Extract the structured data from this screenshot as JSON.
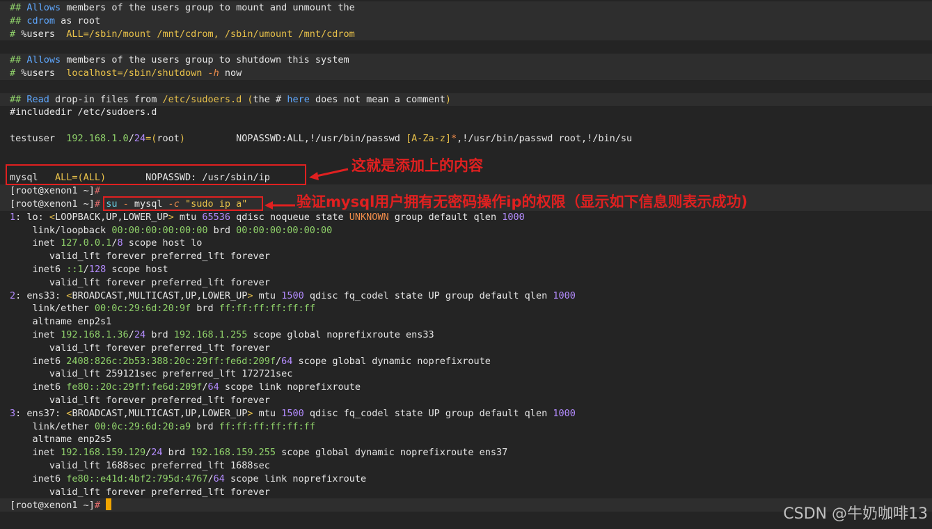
{
  "lines": [
    {
      "row": 0,
      "band": true,
      "segs": [
        {
          "t": "##",
          "c": "cmt"
        },
        {
          "t": " Allows",
          "c": "blue"
        },
        {
          "t": " members of the users group to mount and unmount the",
          "c": "wht"
        }
      ]
    },
    {
      "row": 1,
      "band": true,
      "segs": [
        {
          "t": "##",
          "c": "cmt"
        },
        {
          "t": " cdrom",
          "c": "blue"
        },
        {
          "t": " as root",
          "c": "wht"
        }
      ]
    },
    {
      "row": 2,
      "band": true,
      "segs": [
        {
          "t": "#",
          "c": "cmt"
        },
        {
          "t": " %users  ",
          "c": "wht"
        },
        {
          "t": "ALL=/sbin/mount /mnt/cdrom, /sbin/umount /mnt/cdrom",
          "c": "yel"
        }
      ]
    },
    {
      "row": 4,
      "band": true,
      "segs": [
        {
          "t": "##",
          "c": "cmt"
        },
        {
          "t": " Allows",
          "c": "blue"
        },
        {
          "t": " members of the users group to shutdown this system",
          "c": "wht"
        }
      ]
    },
    {
      "row": 5,
      "band": true,
      "segs": [
        {
          "t": "#",
          "c": "cmt"
        },
        {
          "t": " %users  ",
          "c": "wht"
        },
        {
          "t": "localhost=/sbin/shutdown ",
          "c": "yel"
        },
        {
          "t": "-h",
          "c": "org ital"
        },
        {
          "t": " now",
          "c": "wht"
        }
      ]
    },
    {
      "row": 7,
      "band": true,
      "segs": [
        {
          "t": "##",
          "c": "cmt"
        },
        {
          "t": " Read",
          "c": "blue"
        },
        {
          "t": " drop-in files from ",
          "c": "wht"
        },
        {
          "t": "/etc/sudoers.d",
          "c": "yel"
        },
        {
          "t": " (",
          "c": "yel"
        },
        {
          "t": "the # ",
          "c": "wht"
        },
        {
          "t": "here",
          "c": "blue"
        },
        {
          "t": " does not mean a comment",
          "c": "wht"
        },
        {
          "t": ")",
          "c": "yel"
        }
      ]
    },
    {
      "row": 8,
      "band": false,
      "segs": [
        {
          "t": "#includedir /etc/sudoers.d",
          "c": "wht"
        }
      ]
    },
    {
      "row": 10,
      "band": false,
      "segs": [
        {
          "t": "testuser  ",
          "c": "wht"
        },
        {
          "t": "192.168.1.0",
          "c": "grn"
        },
        {
          "t": "/",
          "c": "wht"
        },
        {
          "t": "24",
          "c": "pur"
        },
        {
          "t": "=(",
          "c": "yel"
        },
        {
          "t": "root",
          "c": "wht"
        },
        {
          "t": ")",
          "c": "yel"
        },
        {
          "t": "         NOPASSWD:ALL,!/usr/bin/passwd ",
          "c": "wht"
        },
        {
          "t": "[A-Za-z]",
          "c": "yel"
        },
        {
          "t": "*",
          "c": "org"
        },
        {
          "t": ",!/usr/bin/passwd root,!/bin/su",
          "c": "wht"
        }
      ]
    },
    {
      "row": 13,
      "band": false,
      "segs": [
        {
          "t": "mysql   ",
          "c": "wht"
        },
        {
          "t": "ALL=(ALL)",
          "c": "yel"
        },
        {
          "t": "       NOPASSWD: /usr/sbin/ip",
          "c": "wht"
        }
      ]
    },
    {
      "row": 14,
      "band": true,
      "segs": [
        {
          "t": "[root@xenon1 ~]",
          "c": "wht"
        },
        {
          "t": "#",
          "c": "red"
        }
      ]
    },
    {
      "row": 15,
      "band": true,
      "segs": [
        {
          "t": "[root@xenon1 ~]",
          "c": "wht"
        },
        {
          "t": "# ",
          "c": "red"
        },
        {
          "t": "su",
          "c": "cya"
        },
        {
          "t": " - ",
          "c": "org"
        },
        {
          "t": "mysql ",
          "c": "wht"
        },
        {
          "t": "-c",
          "c": "org ital"
        },
        {
          "t": " \"sudo ip a\"",
          "c": "yel"
        }
      ]
    },
    {
      "row": 16,
      "band": false,
      "segs": [
        {
          "t": "1",
          "c": "pur"
        },
        {
          "t": ": lo: ",
          "c": "wht"
        },
        {
          "t": "<",
          "c": "yel"
        },
        {
          "t": "LOOPBACK,UP,LOWER_UP",
          "c": "wht"
        },
        {
          "t": ">",
          "c": "yel"
        },
        {
          "t": " mtu ",
          "c": "wht"
        },
        {
          "t": "65536",
          "c": "pur"
        },
        {
          "t": " qdisc noqueue state ",
          "c": "wht"
        },
        {
          "t": "UNKNOWN",
          "c": "org"
        },
        {
          "t": " group default qlen ",
          "c": "wht"
        },
        {
          "t": "1000",
          "c": "pur"
        }
      ]
    },
    {
      "row": 17,
      "band": false,
      "segs": [
        {
          "t": "    link/loopback ",
          "c": "wht"
        },
        {
          "t": "00:00:00:00:00:00",
          "c": "grn"
        },
        {
          "t": " brd ",
          "c": "wht"
        },
        {
          "t": "00:00:00:00:00:00",
          "c": "grn"
        }
      ]
    },
    {
      "row": 18,
      "band": false,
      "segs": [
        {
          "t": "    inet ",
          "c": "wht"
        },
        {
          "t": "127.0.0.1",
          "c": "grn"
        },
        {
          "t": "/",
          "c": "wht"
        },
        {
          "t": "8",
          "c": "pur"
        },
        {
          "t": " scope host lo",
          "c": "wht"
        }
      ]
    },
    {
      "row": 19,
      "band": false,
      "segs": [
        {
          "t": "       valid_lft forever preferred_lft forever",
          "c": "wht"
        }
      ]
    },
    {
      "row": 20,
      "band": false,
      "segs": [
        {
          "t": "    inet6 ",
          "c": "wht"
        },
        {
          "t": "::1",
          "c": "grn"
        },
        {
          "t": "/",
          "c": "wht"
        },
        {
          "t": "128",
          "c": "pur"
        },
        {
          "t": " scope host",
          "c": "wht"
        }
      ]
    },
    {
      "row": 21,
      "band": false,
      "segs": [
        {
          "t": "       valid_lft forever preferred_lft forever",
          "c": "wht"
        }
      ]
    },
    {
      "row": 22,
      "band": false,
      "segs": [
        {
          "t": "2",
          "c": "pur"
        },
        {
          "t": ": ens33: ",
          "c": "wht"
        },
        {
          "t": "<",
          "c": "yel"
        },
        {
          "t": "BROADCAST,MULTICAST,UP,LOWER_UP",
          "c": "wht"
        },
        {
          "t": ">",
          "c": "yel"
        },
        {
          "t": " mtu ",
          "c": "wht"
        },
        {
          "t": "1500",
          "c": "pur"
        },
        {
          "t": " qdisc fq_codel state UP group default qlen ",
          "c": "wht"
        },
        {
          "t": "1000",
          "c": "pur"
        }
      ]
    },
    {
      "row": 23,
      "band": false,
      "segs": [
        {
          "t": "    link/ether ",
          "c": "wht"
        },
        {
          "t": "00:0c:29:6d:20:9f",
          "c": "grn"
        },
        {
          "t": " brd ",
          "c": "wht"
        },
        {
          "t": "ff:ff:ff:ff:ff:ff",
          "c": "grn"
        }
      ]
    },
    {
      "row": 24,
      "band": false,
      "segs": [
        {
          "t": "    altname enp2s1",
          "c": "wht"
        }
      ]
    },
    {
      "row": 25,
      "band": false,
      "segs": [
        {
          "t": "    inet ",
          "c": "wht"
        },
        {
          "t": "192.168.1.36",
          "c": "grn"
        },
        {
          "t": "/",
          "c": "wht"
        },
        {
          "t": "24",
          "c": "pur"
        },
        {
          "t": " brd ",
          "c": "wht"
        },
        {
          "t": "192.168.1.255",
          "c": "grn"
        },
        {
          "t": " scope global noprefixroute ens33",
          "c": "wht"
        }
      ]
    },
    {
      "row": 26,
      "band": false,
      "segs": [
        {
          "t": "       valid_lft forever preferred_lft forever",
          "c": "wht"
        }
      ]
    },
    {
      "row": 27,
      "band": false,
      "segs": [
        {
          "t": "    inet6 ",
          "c": "wht"
        },
        {
          "t": "2408:826c:2b53:388:20c:29ff:fe6d:209f",
          "c": "grn"
        },
        {
          "t": "/",
          "c": "wht"
        },
        {
          "t": "64",
          "c": "pur"
        },
        {
          "t": " scope global dynamic noprefixroute",
          "c": "wht"
        }
      ]
    },
    {
      "row": 28,
      "band": false,
      "segs": [
        {
          "t": "       valid_lft 259121sec preferred_lft 172721sec",
          "c": "wht"
        }
      ]
    },
    {
      "row": 29,
      "band": false,
      "segs": [
        {
          "t": "    inet6 ",
          "c": "wht"
        },
        {
          "t": "fe80::20c:29ff:fe6d:209f",
          "c": "grn"
        },
        {
          "t": "/",
          "c": "wht"
        },
        {
          "t": "64",
          "c": "pur"
        },
        {
          "t": " scope link noprefixroute",
          "c": "wht"
        }
      ]
    },
    {
      "row": 30,
      "band": false,
      "segs": [
        {
          "t": "       valid_lft forever preferred_lft forever",
          "c": "wht"
        }
      ]
    },
    {
      "row": 31,
      "band": false,
      "segs": [
        {
          "t": "3",
          "c": "pur"
        },
        {
          "t": ": ens37: ",
          "c": "wht"
        },
        {
          "t": "<",
          "c": "yel"
        },
        {
          "t": "BROADCAST,MULTICAST,UP,LOWER_UP",
          "c": "wht"
        },
        {
          "t": ">",
          "c": "yel"
        },
        {
          "t": " mtu ",
          "c": "wht"
        },
        {
          "t": "1500",
          "c": "pur"
        },
        {
          "t": " qdisc fq_codel state UP group default qlen ",
          "c": "wht"
        },
        {
          "t": "1000",
          "c": "pur"
        }
      ]
    },
    {
      "row": 32,
      "band": false,
      "segs": [
        {
          "t": "    link/ether ",
          "c": "wht"
        },
        {
          "t": "00:0c:29:6d:20:a9",
          "c": "grn"
        },
        {
          "t": " brd ",
          "c": "wht"
        },
        {
          "t": "ff:ff:ff:ff:ff:ff",
          "c": "grn"
        }
      ]
    },
    {
      "row": 33,
      "band": false,
      "segs": [
        {
          "t": "    altname enp2s5",
          "c": "wht"
        }
      ]
    },
    {
      "row": 34,
      "band": false,
      "segs": [
        {
          "t": "    inet ",
          "c": "wht"
        },
        {
          "t": "192.168.159.129",
          "c": "grn"
        },
        {
          "t": "/",
          "c": "wht"
        },
        {
          "t": "24",
          "c": "pur"
        },
        {
          "t": " brd ",
          "c": "wht"
        },
        {
          "t": "192.168.159.255",
          "c": "grn"
        },
        {
          "t": " scope global dynamic noprefixroute ens37",
          "c": "wht"
        }
      ]
    },
    {
      "row": 35,
      "band": false,
      "segs": [
        {
          "t": "       valid_lft 1688sec preferred_lft 1688sec",
          "c": "wht"
        }
      ]
    },
    {
      "row": 36,
      "band": false,
      "segs": [
        {
          "t": "    inet6 ",
          "c": "wht"
        },
        {
          "t": "fe80::e41d:4bf2:795d:4767",
          "c": "grn"
        },
        {
          "t": "/",
          "c": "wht"
        },
        {
          "t": "64",
          "c": "pur"
        },
        {
          "t": " scope link noprefixroute",
          "c": "wht"
        }
      ]
    },
    {
      "row": 37,
      "band": false,
      "segs": [
        {
          "t": "       valid_lft forever preferred_lft forever",
          "c": "wht"
        }
      ]
    },
    {
      "row": 38,
      "band": true,
      "segs": [
        {
          "t": "[root@xenon1 ~]",
          "c": "wht"
        },
        {
          "t": "# ",
          "c": "red"
        }
      ],
      "cursor": true
    }
  ],
  "annotations": {
    "added_content": "这就是添加上的内容",
    "verify_note": "验证mysql用户拥有无密码操作ip的权限（显示如下信息则表示成功)"
  },
  "watermark": "CSDN @牛奶咖啡13"
}
